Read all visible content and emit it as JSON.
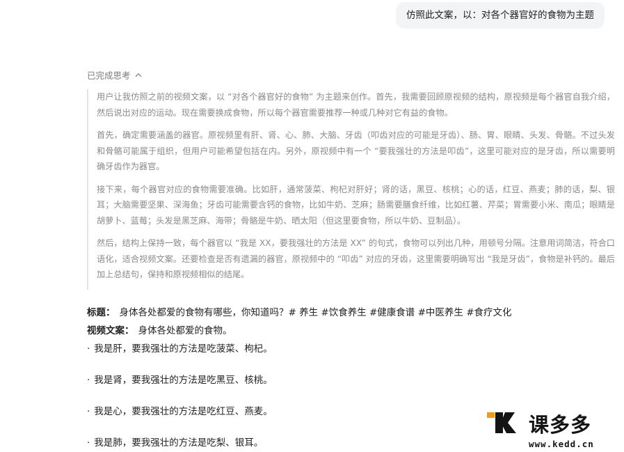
{
  "user_message": "仿照此文案，以：对各个器官好的食物为主题",
  "thinking": {
    "toggle_label": "已完成思考",
    "paragraphs": [
      "用户让我仿照之前的视频文案，以 “对各个器官好的食物” 为主题来创作。首先，我需要回顾原视频的结构，原视频是每个器官自我介绍，然后说出对应的运动。现在需要换成食物，所以每个器官需要推荐一种或几种对它有益的食物。",
      "首先，确定需要涵盖的器官。原视频里有肝、肾、心、肺、大脑、牙齿（叩齿对应的可能是牙齿）、肠、胃、眼睛、头发、骨骼。不过头发和骨骼可能属于组织，但用户可能希望包括在内。另外，原视频中有一个 “要我强壮的方法是叩齿”，这里可能对应的是牙齿，所以需要明确牙齿作为器官。",
      "接下来，每个器官对应的食物需要准确。比如肝，通常菠菜、枸杞对肝好；肾的话，黑豆、核桃；心的话，红豆、燕麦；肺的话，梨、银耳；大脑需要坚果、深海鱼；牙齿可能需要含钙的食物，比如牛奶、芝麻；肠需要膳食纤维，比如红薯、芹菜；胃需要小米、南瓜；眼睛是胡萝卜、蓝莓；头发是黑芝麻、海带；骨骼是牛奶、晒太阳（但这里要食物，所以牛奶、豆制品）。",
      "然后，结构上保持一致，每个器官以 “我是 XX，要我强壮的方法是 XX” 的句式，食物可以列出几种，用顿号分隔。注意用词简洁，符合口语化，适合视频文案。还要检查是否有遗漏的器官，原视频中的 “叩齿” 对应的牙齿，这里需要明确写出 “我是牙齿”，食物是补钙的。最后加上总结句，保持和原视频相似的结尾。"
    ]
  },
  "answer": {
    "title_label": "标题：",
    "title_text": "身体各处都爱的食物有哪些，你知道吗？# 养生 #饮食养生 #健康食谱 #中医养生 #食疗文化",
    "script_label": "视频文案：",
    "script_text": "身体各处都爱的食物。",
    "bullet_char": "·",
    "items": [
      "我是肝，要我强壮的方法是吃菠菜、枸杞。",
      "我是肾，要我强壮的方法是吃黑豆、核桃。",
      "我是心，要我强壮的方法是吃红豆、燕麦。",
      "我是肺，要我强壮的方法是吃梨、银耳。"
    ]
  },
  "watermark": {
    "brand": "课多多",
    "url": "www.kedd.cn",
    "accent_color": "#f39a1c",
    "text_color": "#141414"
  }
}
